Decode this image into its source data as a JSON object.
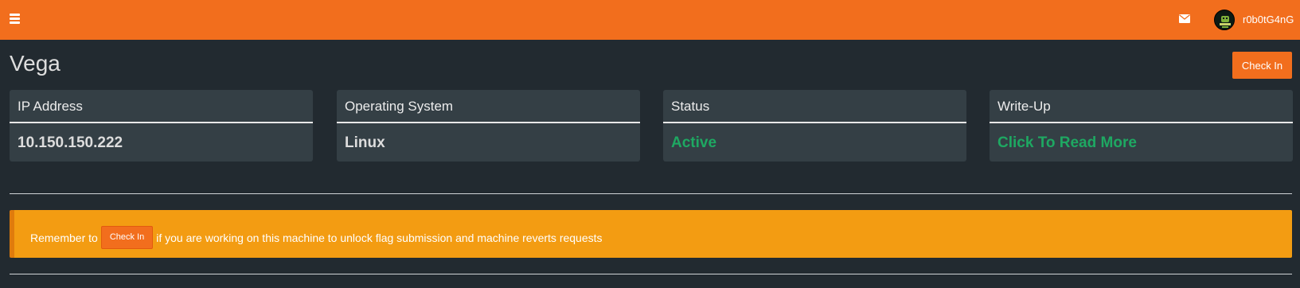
{
  "navbar": {
    "menu_icon": "hamburger-icon",
    "mail_icon": "envelope-icon",
    "username": "r0b0tG4nG",
    "accent_color": "#f26e1d"
  },
  "page": {
    "title": "Vega",
    "check_in_label": "Check In"
  },
  "cards": [
    {
      "label": "IP Address",
      "value": "10.150.150.222"
    },
    {
      "label": "Operating System",
      "value": "Linux"
    },
    {
      "label": "Status",
      "value": "Active",
      "value_color": "#1ea862"
    },
    {
      "label": "Write-Up",
      "value": "Click To Read More",
      "value_color": "#1ea862"
    }
  ],
  "alert": {
    "text_before": "Remember to",
    "button_label": "Check In",
    "text_after": "if you are working on this machine to unlock flag submission and machine reverts requests",
    "background_color": "#f39c12"
  }
}
